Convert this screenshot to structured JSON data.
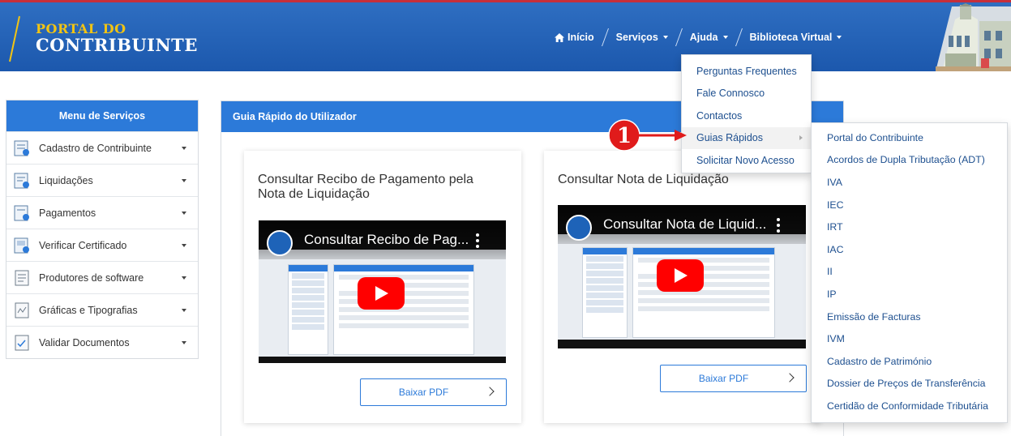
{
  "header": {
    "logo_line1": "PORTAL DO",
    "logo_line2": "CONTRIBUINTE",
    "nav": {
      "home": "Início",
      "services": "Serviços",
      "help": "Ajuda",
      "library": "Biblioteca Virtual"
    }
  },
  "menu": {
    "title": "Menu de Serviços",
    "items": [
      {
        "label": "Cadastro de Contribuinte",
        "icon": "registry-icon"
      },
      {
        "label": "Liquidações",
        "icon": "settlement-icon"
      },
      {
        "label": "Pagamentos",
        "icon": "payment-icon"
      },
      {
        "label": "Verificar Certificado",
        "icon": "certificate-icon"
      },
      {
        "label": "Produtores de software",
        "icon": "software-icon"
      },
      {
        "label": "Gráficas e Tipografias",
        "icon": "print-icon"
      },
      {
        "label": "Validar Documentos",
        "icon": "document-check-icon"
      }
    ]
  },
  "panel": {
    "title": "Guia Rápido do Utilizador",
    "cards": [
      {
        "title": "Consultar Recibo de Pagamento pela Nota de Liquidação",
        "video_title": "Consultar Recibo de Pag...",
        "button": "Baixar PDF"
      },
      {
        "title": "Consultar Nota de Liquidação",
        "video_title": "Consultar Nota de Liquid...",
        "button": "Baixar PDF"
      }
    ]
  },
  "help_menu": {
    "items": [
      "Perguntas Frequentes",
      "Fale Connosco",
      "Contactos",
      "Guias Rápidos",
      "Solicitar Novo Acesso"
    ]
  },
  "guides_submenu": {
    "items": [
      "Portal do Contribuinte",
      "Acordos de Dupla Tributação (ADT)",
      "IVA",
      "IEC",
      "IRT",
      "IAC",
      "II",
      "IP",
      "Emissão de Facturas",
      "IVM",
      "Cadastro de Património",
      "Dossier de Preços de Transferência",
      "Certidão de Conformidade Tributária"
    ]
  },
  "annotation": {
    "step": "1"
  },
  "colors": {
    "header": "#1c58ad",
    "accent": "#2c7ad9",
    "gold": "#f2c413",
    "annotation": "#e01b1b",
    "top_line": "#c62f3b"
  }
}
